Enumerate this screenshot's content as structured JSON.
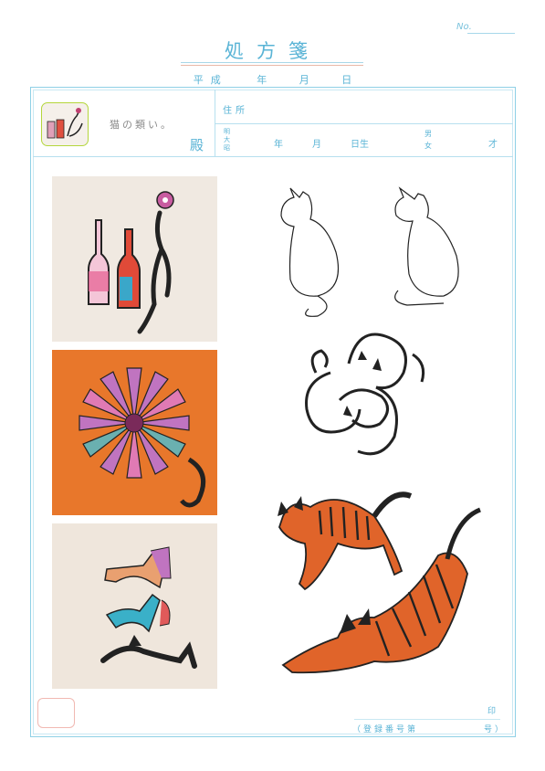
{
  "header": {
    "number_label": "No.",
    "title": "処方箋",
    "date": {
      "era": "平成",
      "year": "年",
      "month": "月",
      "day": "日"
    }
  },
  "patient": {
    "name": "猫の類い。",
    "honorific": "殿",
    "address_label": "住所",
    "birth_era": [
      "明",
      "大",
      "昭"
    ],
    "birth_year": "年",
    "birth_month": "月",
    "birth_day": "日生",
    "sex": [
      "男",
      "女"
    ],
    "age": "才"
  },
  "footer": {
    "seal": "印",
    "registration": "（登録番号第　　　　　　号）"
  },
  "artwork": [
    {
      "subject": "bottles-and-cat-with-flower",
      "bg": "#f0e9e1"
    },
    {
      "subject": "flower-cat",
      "bg": "#e8772b"
    },
    {
      "subject": "shoes-and-cat",
      "bg": "#efe6dc"
    },
    {
      "subject": "sketch-cats",
      "bg": "#ffffff"
    },
    {
      "subject": "intertwined-cats",
      "bg": "#ffffff"
    },
    {
      "subject": "tabby-cats-stretching",
      "bg": "#ffffff"
    }
  ],
  "colors": {
    "accent": "#5ab4d6",
    "stamp": "#f1b9b2",
    "orange": "#e0642a"
  }
}
